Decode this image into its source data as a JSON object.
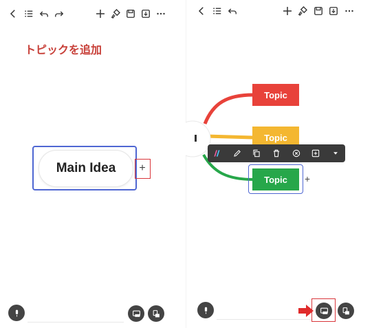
{
  "left": {
    "annotation": "トピックを追加",
    "main_idea": "Main Idea",
    "plus": "+"
  },
  "right": {
    "topics": [
      "Topic",
      "Topic",
      "Topic"
    ],
    "plus": "+"
  },
  "colors": {
    "topic_red": "#e8423a",
    "topic_yellow": "#f4b731",
    "topic_green": "#27a74a",
    "selection_blue": "#4e66d2",
    "highlight_red": "#d9353a",
    "toolbar_bg": "#3a3a3a",
    "annotation_red": "#c8413a"
  },
  "icons": {
    "top_toolbar_left": [
      "back-icon",
      "outline-list-icon",
      "undo-icon",
      "redo-icon",
      "add-icon",
      "format-brush-icon",
      "save-icon",
      "export-icon",
      "more-icon"
    ],
    "top_toolbar_right": [
      "back-icon",
      "outline-list-icon",
      "undo-icon",
      "add-icon",
      "format-brush-icon",
      "save-icon",
      "export-icon",
      "more-icon"
    ],
    "context_toolbar": [
      "style-icon",
      "edit-icon",
      "copy-icon",
      "delete-icon",
      "close-icon",
      "add-subtopic-icon",
      "more-down-icon"
    ],
    "bottom": [
      "mic-icon",
      "view-icon",
      "layout-icon"
    ]
  }
}
